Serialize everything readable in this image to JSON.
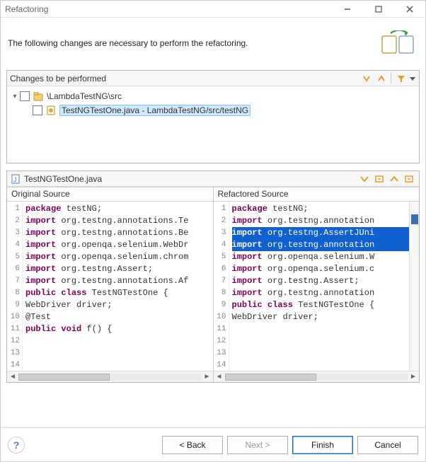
{
  "window": {
    "title": "Refactoring"
  },
  "header": {
    "message": "The following changes are necessary to perform the refactoring."
  },
  "changes": {
    "title": "Changes to be performed",
    "tree": {
      "root": {
        "label": "\\LambdaTestNG\\src"
      },
      "child": {
        "label": "TestNGTestOne.java - LambdaTestNG/src/testNG"
      }
    }
  },
  "compare": {
    "file": "TestNGTestOne.java",
    "left_title": "Original Source",
    "right_title": "Refactored Source",
    "left_lines": [
      "package testNG;",
      "",
      "import org.testng.annotations.Te",
      "import org.testng.annotations.Be",
      "import org.openqa.selenium.WebDr",
      "import org.openqa.selenium.chrom",
      "import org.testng.Assert;",
      "import org.testng.annotations.Af",
      "",
      "public class TestNGTestOne {",
      "    WebDriver driver;",
      "",
      "  @Test",
      "  public void f() {"
    ],
    "right_lines": [
      "package testNG;",
      "",
      "import org.testng.annotation",
      "import org.testng.AssertJUni",
      "import org.testng.annotation",
      "import org.openqa.selenium.W",
      "import org.openqa.selenium.c",
      "import org.testng.Assert;",
      "import org.testng.annotation",
      "",
      "public class TestNGTestOne {",
      "    WebDriver driver;",
      ""
    ],
    "right_visible_count": 14
  },
  "buttons": {
    "back": "< Back",
    "next": "Next >",
    "finish": "Finish",
    "cancel": "Cancel"
  }
}
